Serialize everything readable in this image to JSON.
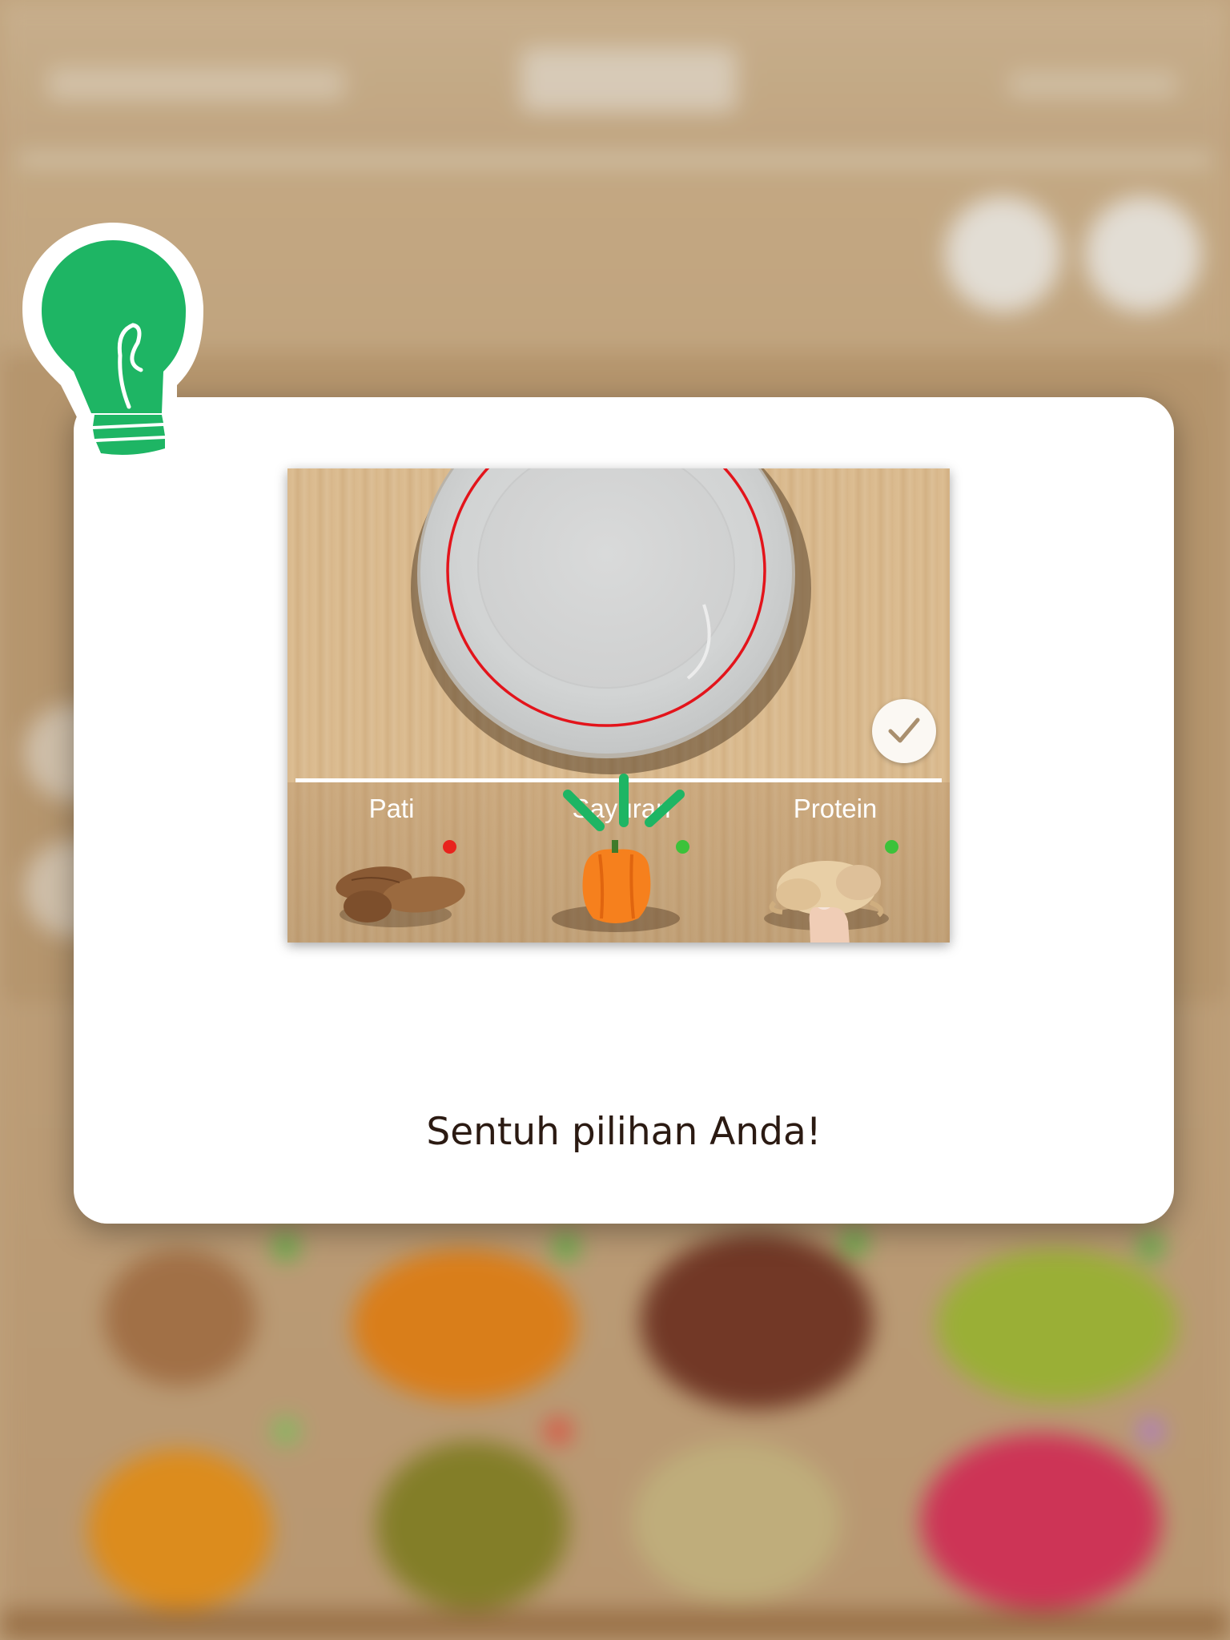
{
  "tutorial": {
    "categories": [
      {
        "label": "Pati",
        "food": "sweet-potato",
        "dot_color": "#e8231d"
      },
      {
        "label": "Sayuran",
        "food": "orange-bell-pepper",
        "dot_color": "#3cc23a"
      },
      {
        "label": "Protein",
        "food": "raw-chicken",
        "dot_color": "#3cc23a"
      }
    ],
    "selected_category": "Sayuran",
    "plate_ring_color": "#e3141b",
    "done_icon": "check-icon"
  },
  "instruction": "Sentuh pilihan Anda!",
  "colors": {
    "hint_bulb": "#1eb564",
    "modal_bg": "#ffffff",
    "text": "#2b1a12",
    "tap_lines": "#1eb564"
  },
  "icons": {
    "hint": "lightbulb-icon",
    "pointer": "pointing-hand",
    "confirm": "check-icon"
  }
}
